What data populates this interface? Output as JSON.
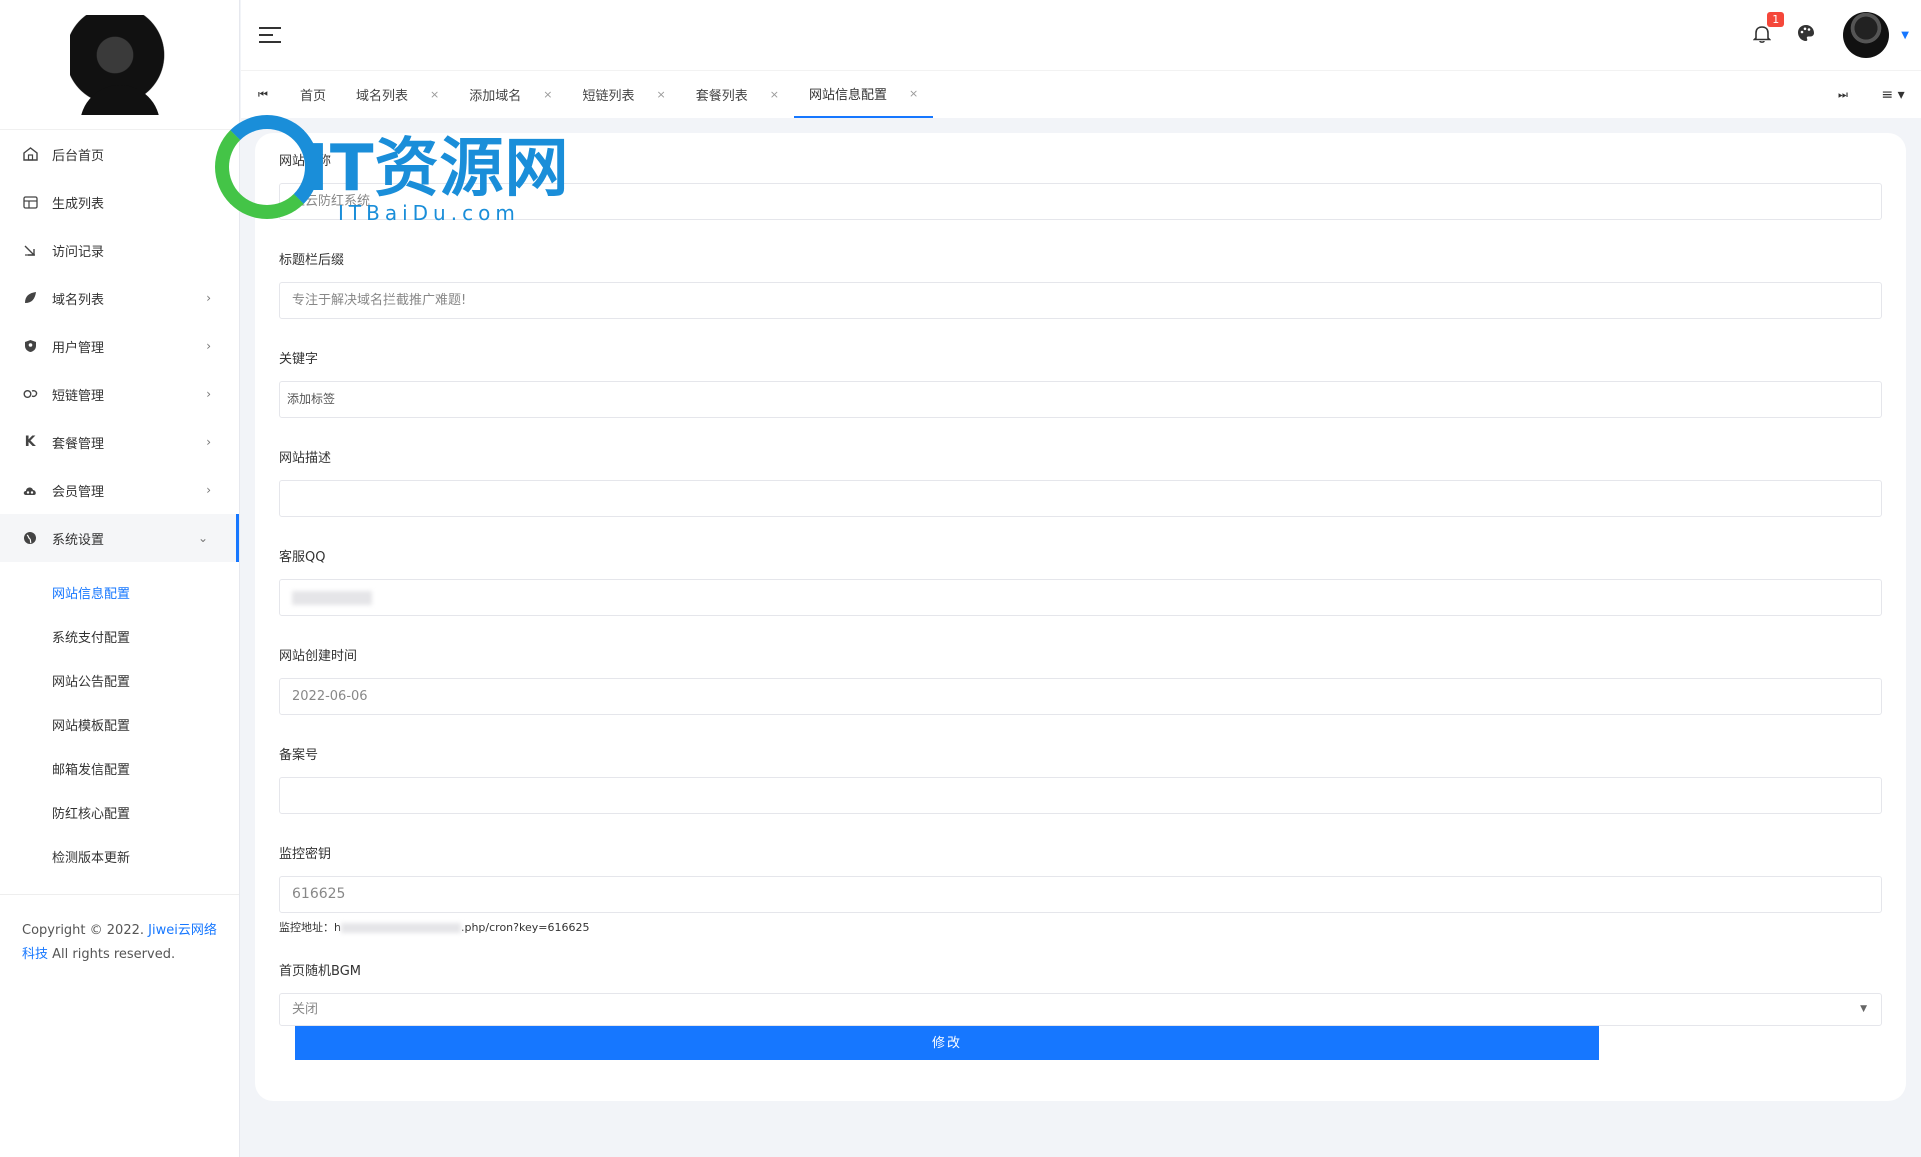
{
  "sidebar": {
    "items": [
      {
        "label": "后台首页",
        "icon": "home-icon",
        "expandable": false
      },
      {
        "label": "生成列表",
        "icon": "table-icon",
        "expandable": false
      },
      {
        "label": "访问记录",
        "icon": "arrow-icon",
        "expandable": false
      },
      {
        "label": "域名列表",
        "icon": "leaf-icon",
        "expandable": true
      },
      {
        "label": "用户管理",
        "icon": "shield-icon",
        "expandable": true
      },
      {
        "label": "短链管理",
        "icon": "link-icon",
        "expandable": true
      },
      {
        "label": "套餐管理",
        "icon": "k-icon",
        "expandable": true
      },
      {
        "label": "会员管理",
        "icon": "cloud-icon",
        "expandable": true
      },
      {
        "label": "系统设置",
        "icon": "globe-icon",
        "expandable": true,
        "open": true
      }
    ],
    "sub_items": [
      "网站信息配置",
      "系统支付配置",
      "网站公告配置",
      "网站模板配置",
      "邮箱发信配置",
      "防红核心配置",
      "检测版本更新"
    ],
    "active_sub": "网站信息配置",
    "copyright_prefix": "Copyright © 2022.",
    "copyright_link": "Jiwei云网络科技",
    "copyright_suffix": "All rights reserved."
  },
  "header": {
    "notification_count": "1",
    "accent_color": "#1677ff"
  },
  "tabs": [
    {
      "label": "首页",
      "closable": false
    },
    {
      "label": "域名列表",
      "closable": true
    },
    {
      "label": "添加域名",
      "closable": true
    },
    {
      "label": "短链列表",
      "closable": true
    },
    {
      "label": "套餐列表",
      "closable": true
    },
    {
      "label": "网站信息配置",
      "closable": true,
      "active": true
    }
  ],
  "form": {
    "site_name_label": "网站名称",
    "site_name_value": "卫云防红系统",
    "title_suffix_label": "标题栏后缀",
    "title_suffix_value": "专注于解决域名拦截推广难题!",
    "keywords_label": "关键字",
    "keywords_placeholder": "添加标签",
    "description_label": "网站描述",
    "description_value": "",
    "qq_label": "客服QQ",
    "created_label": "网站创建时间",
    "created_value": "2022-06-06",
    "icp_label": "备案号",
    "icp_value": "",
    "monitor_key_label": "监控密钥",
    "monitor_key_value": "616625",
    "monitor_url_prefix": "监控地址：h",
    "monitor_url_suffix": ".php/cron?key=616625",
    "bgm_label": "首页随机BGM",
    "bgm_value": "关闭",
    "submit_label": "修改"
  },
  "watermark": {
    "title": "IT资源网",
    "subtitle": "ITBaiDu.com"
  }
}
